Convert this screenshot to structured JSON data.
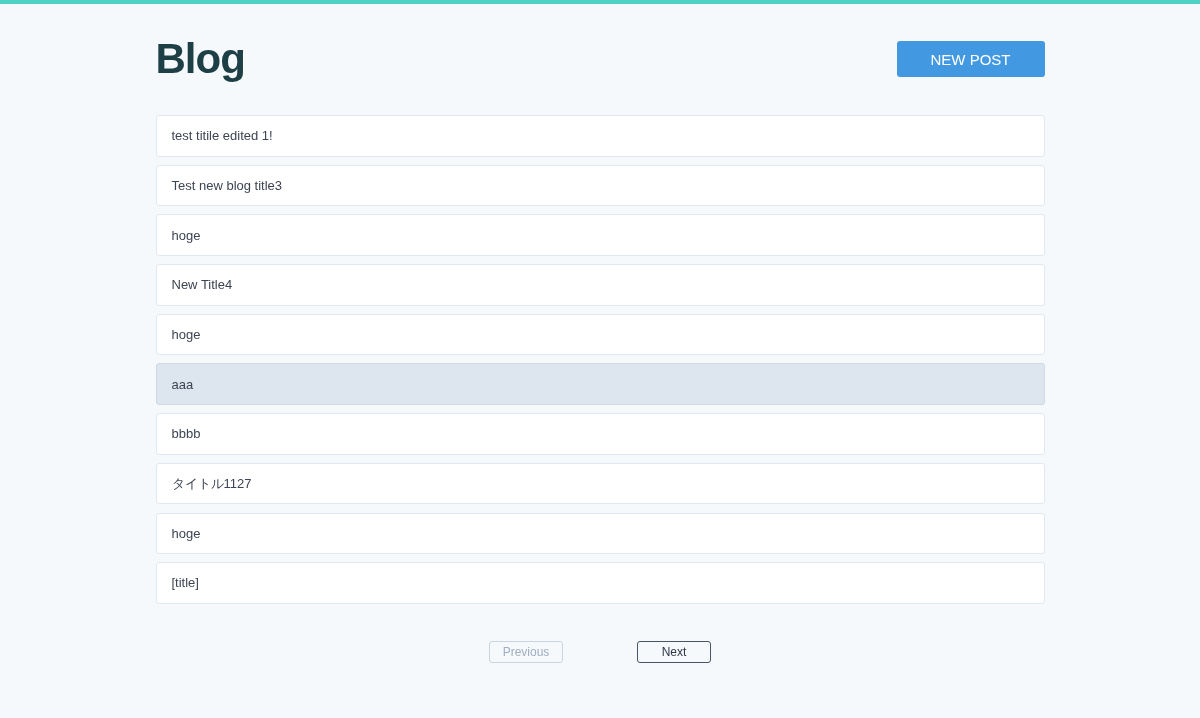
{
  "header": {
    "title": "Blog",
    "new_post_button": "NEW POST"
  },
  "posts": [
    {
      "title": "test titile edited 1!",
      "highlighted": false
    },
    {
      "title": "Test new blog title3",
      "highlighted": false
    },
    {
      "title": "hoge",
      "highlighted": false
    },
    {
      "title": "New Title4",
      "highlighted": false
    },
    {
      "title": "hoge",
      "highlighted": false
    },
    {
      "title": "aaa",
      "highlighted": true
    },
    {
      "title": "bbbb",
      "highlighted": false
    },
    {
      "title": "タイトル1127",
      "highlighted": false
    },
    {
      "title": "hoge",
      "highlighted": false
    },
    {
      "title": "[title]",
      "highlighted": false
    }
  ],
  "pagination": [
    {
      "label": "Previous",
      "disabled": true
    },
    {
      "label": "Next",
      "disabled": false
    }
  ]
}
